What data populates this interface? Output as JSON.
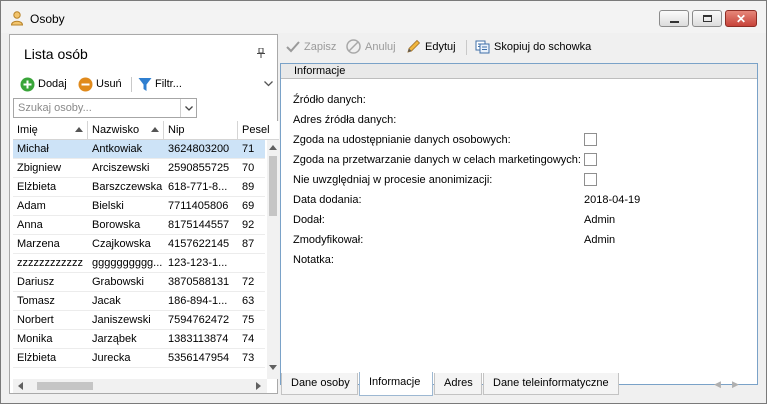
{
  "window": {
    "title": "Osoby"
  },
  "left": {
    "title": "Lista osób",
    "toolbar": {
      "add_label": "Dodaj",
      "remove_label": "Usuń",
      "filter_label": "Filtr..."
    },
    "search": {
      "placeholder": "Szukaj osoby...",
      "value": ""
    },
    "columns": [
      "Imię",
      "Nazwisko",
      "Nip",
      "Pesel"
    ],
    "rows": [
      {
        "imie": "Michał",
        "nazwisko": "Antkowiak",
        "nip": "3624803200",
        "pesel": "71"
      },
      {
        "imie": "Zbigniew",
        "nazwisko": "Arciszewski",
        "nip": "2590855725",
        "pesel": "70"
      },
      {
        "imie": "Elżbieta",
        "nazwisko": "Barszczewska",
        "nip": "618-771-8...",
        "pesel": "89"
      },
      {
        "imie": "Adam",
        "nazwisko": "Bielski",
        "nip": "7711405806",
        "pesel": "69"
      },
      {
        "imie": "Anna",
        "nazwisko": "Borowska",
        "nip": "8175144557",
        "pesel": "92"
      },
      {
        "imie": "Marzena",
        "nazwisko": "Czajkowska",
        "nip": "4157622145",
        "pesel": "87"
      },
      {
        "imie": "zzzzzzzzzzzz",
        "nazwisko": "gggggggggg...",
        "nip": "123-123-1...",
        "pesel": ""
      },
      {
        "imie": "Dariusz",
        "nazwisko": "Grabowski",
        "nip": "3870588131",
        "pesel": "72"
      },
      {
        "imie": "Tomasz",
        "nazwisko": "Jacak",
        "nip": "186-894-1...",
        "pesel": "63"
      },
      {
        "imie": "Norbert",
        "nazwisko": "Janiszewski",
        "nip": "7594762472",
        "pesel": "75"
      },
      {
        "imie": "Monika",
        "nazwisko": "Jarząbek",
        "nip": "1383113874",
        "pesel": "74"
      },
      {
        "imie": "Elżbieta",
        "nazwisko": "Jurecka",
        "nip": "5356147954",
        "pesel": "73"
      }
    ],
    "selected_row": 0
  },
  "right": {
    "toolbar": {
      "save_label": "Zapisz",
      "cancel_label": "Anuluj",
      "edit_label": "Edytuj",
      "copy_label": "Skopiuj do schowka"
    },
    "section_title": "Informacje",
    "fields": {
      "source_label": "Źródło danych:",
      "source_address_label": "Adres źródła danych:",
      "consent_share_label": "Zgoda na udostępnianie danych osobowych:",
      "consent_share_checked": false,
      "consent_marketing_label": "Zgoda na przetwarzanie danych w celach marketingowych:",
      "consent_marketing_checked": false,
      "anonymization_label": "Nie uwzględniaj w procesie anonimizacji:",
      "anonymization_checked": false,
      "date_added_label": "Data dodania:",
      "date_added_value": "2018-04-19",
      "added_by_label": "Dodał:",
      "added_by_value": "Admin",
      "modified_by_label": "Zmodyfikował:",
      "modified_by_value": "Admin",
      "note_label": "Notatka:"
    },
    "tabs": [
      "Dane osoby",
      "Informacje",
      "Adres",
      "Dane teleinformatyczne"
    ],
    "active_tab": 1
  },
  "colors": {
    "selected_row": "#cde3f7",
    "panel_border": "#7aa2c8",
    "add_icon": "#3aa53a",
    "remove_icon": "#e08a1c",
    "filter_icon": "#2f7fd0",
    "close_button": "#c7433a"
  }
}
